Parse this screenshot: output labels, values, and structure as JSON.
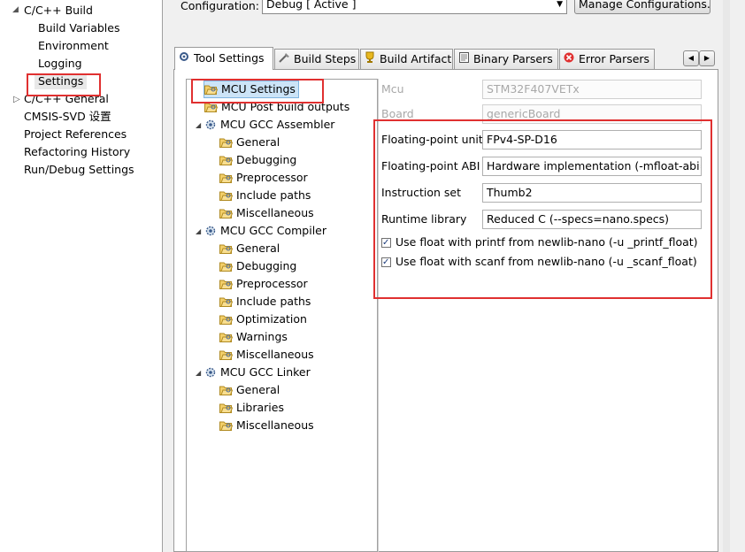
{
  "left_nav": {
    "items": [
      {
        "label": "C/C++ Build",
        "expanded": true
      },
      {
        "label": "Build Variables"
      },
      {
        "label": "Environment"
      },
      {
        "label": "Logging"
      },
      {
        "label": "Settings",
        "selected": true
      },
      {
        "label": "C/C++ General",
        "expanded": false
      },
      {
        "label": "CMSIS-SVD 设置"
      },
      {
        "label": "Project References"
      },
      {
        "label": "Refactoring History"
      },
      {
        "label": "Run/Debug Settings"
      }
    ]
  },
  "config": {
    "label": "Configuration:",
    "value": "Debug  [ Active ]",
    "manage_button": "Manage Configurations..."
  },
  "tabs": [
    {
      "label": "Tool Settings",
      "icon": "tool-settings-icon",
      "active": true
    },
    {
      "label": "Build Steps",
      "icon": "build-steps-icon"
    },
    {
      "label": "Build Artifact",
      "icon": "build-artifact-icon"
    },
    {
      "label": "Binary Parsers",
      "icon": "binary-parsers-icon"
    },
    {
      "label": "Error Parsers",
      "icon": "error-parsers-icon"
    }
  ],
  "tree": {
    "items": [
      {
        "label": "MCU Settings",
        "level": 0,
        "selected": true
      },
      {
        "label": "MCU Post build outputs",
        "level": 0
      },
      {
        "label": "MCU GCC Assembler",
        "level": 0,
        "expanded": true
      },
      {
        "label": "General",
        "level": 1
      },
      {
        "label": "Debugging",
        "level": 1
      },
      {
        "label": "Preprocessor",
        "level": 1
      },
      {
        "label": "Include paths",
        "level": 1
      },
      {
        "label": "Miscellaneous",
        "level": 1
      },
      {
        "label": "MCU GCC Compiler",
        "level": 0,
        "expanded": true
      },
      {
        "label": "General",
        "level": 1
      },
      {
        "label": "Debugging",
        "level": 1
      },
      {
        "label": "Preprocessor",
        "level": 1
      },
      {
        "label": "Include paths",
        "level": 1
      },
      {
        "label": "Optimization",
        "level": 1
      },
      {
        "label": "Warnings",
        "level": 1
      },
      {
        "label": "Miscellaneous",
        "level": 1
      },
      {
        "label": "MCU GCC Linker",
        "level": 0,
        "expanded": true
      },
      {
        "label": "General",
        "level": 1
      },
      {
        "label": "Libraries",
        "level": 1
      },
      {
        "label": "Miscellaneous",
        "level": 1
      }
    ]
  },
  "settings": {
    "mcu_label": "Mcu",
    "mcu_value": "STM32F407VETx",
    "board_label": "Board",
    "board_value": "genericBoard",
    "fpu_label": "Floating-point unit",
    "fpu_value": "FPv4-SP-D16",
    "abi_label": "Floating-point ABI",
    "abi_value": "Hardware implementation (-mfloat-abi=hard)",
    "iset_label": "Instruction set",
    "iset_value": "Thumb2",
    "runtime_label": "Runtime library",
    "runtime_value": "Reduced C (--specs=nano.specs)",
    "printf_float": "Use float with printf from newlib-nano (-u _printf_float)",
    "scanf_float": "Use float with scanf from newlib-nano (-u _scanf_float)"
  },
  "colors": {
    "highlight_box": "#e03030",
    "selection": "#cce4f7",
    "selection_border": "#7fb4e0"
  }
}
